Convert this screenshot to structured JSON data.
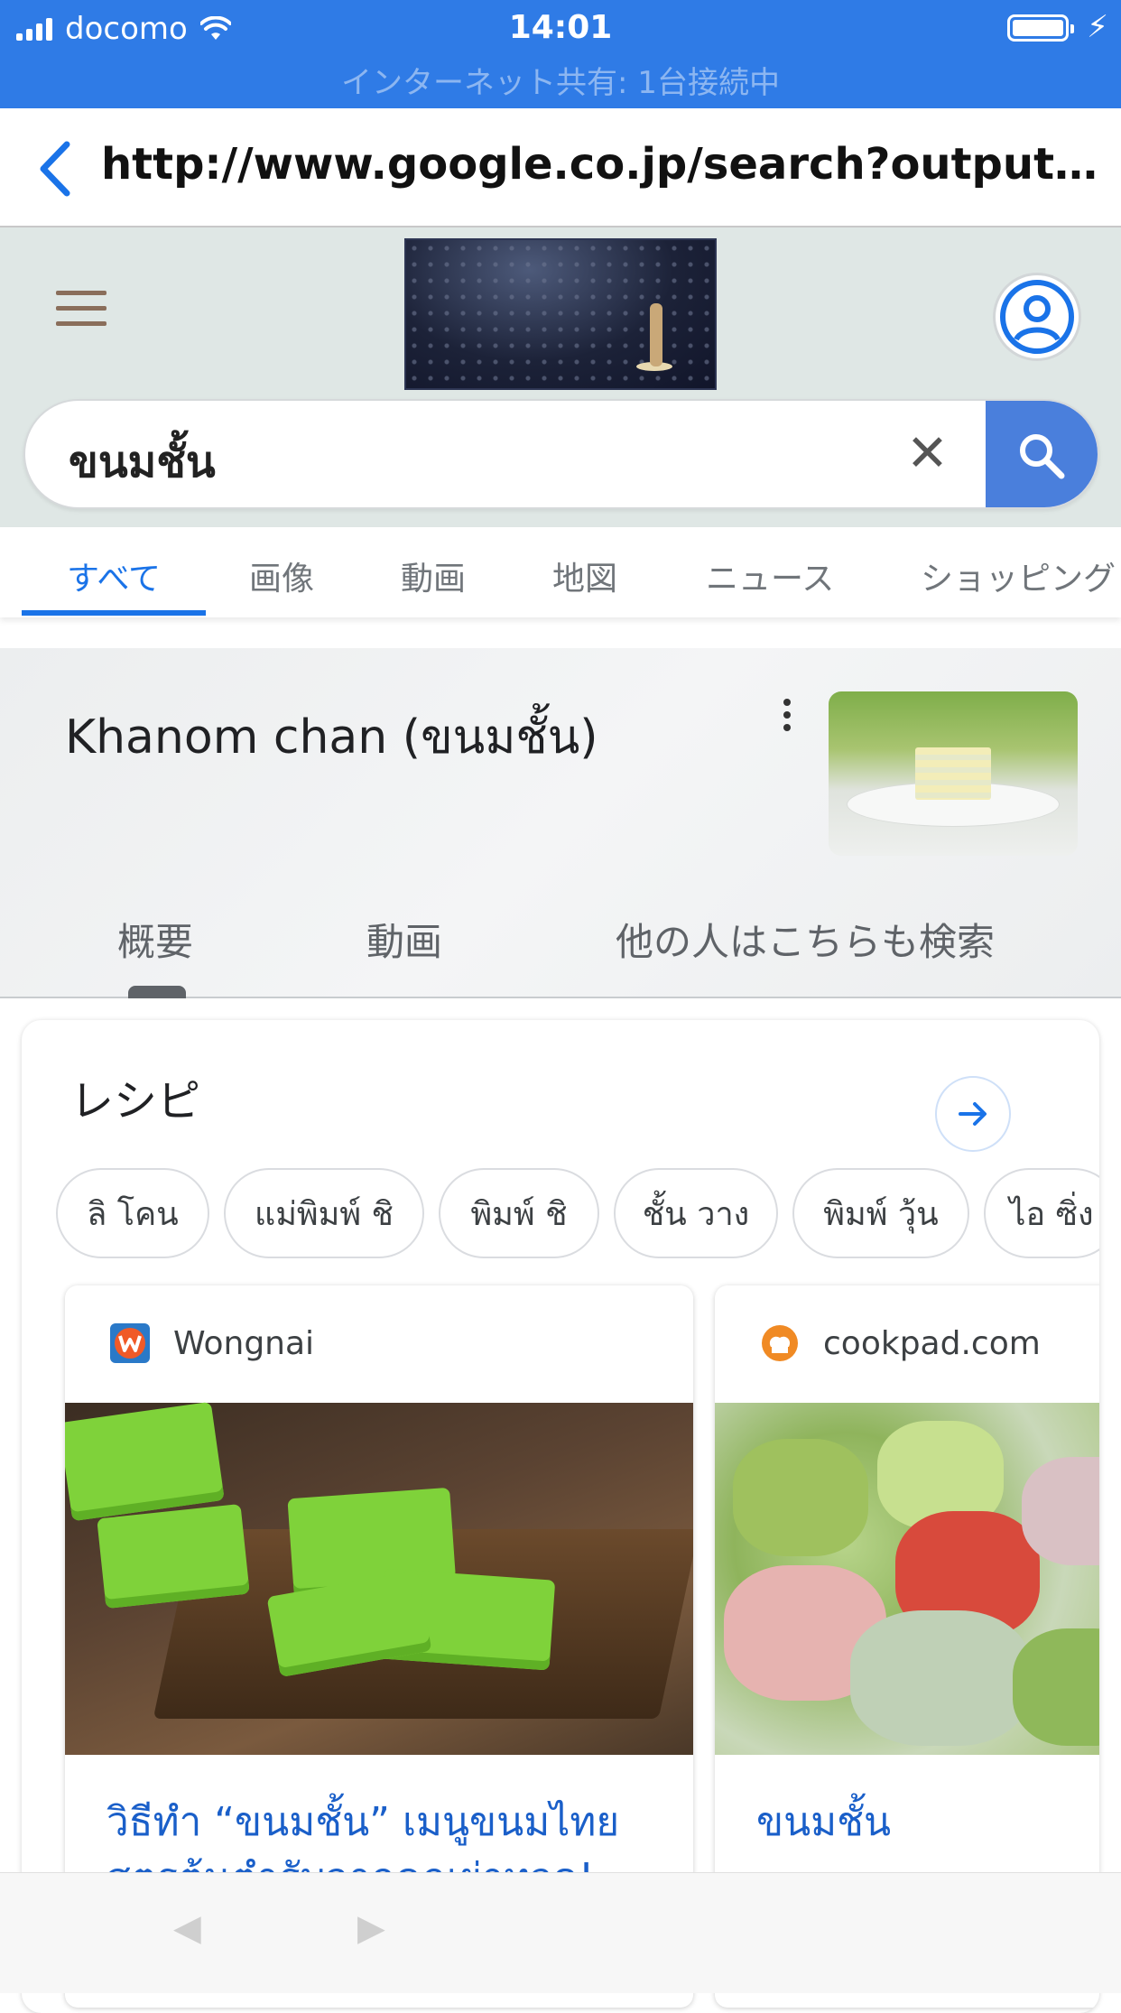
{
  "status_bar": {
    "carrier": "docomo",
    "time": "14:01",
    "hotspot": "インターネット共有: 1台接続中"
  },
  "browser": {
    "url": "http://www.google.co.jp/search?output=&s..."
  },
  "search": {
    "query": "ขนมชั้น",
    "clear_glyph": "✕"
  },
  "tabs": [
    {
      "label": "すべて",
      "active": true
    },
    {
      "label": "画像"
    },
    {
      "label": "動画"
    },
    {
      "label": "地図"
    },
    {
      "label": "ニュース"
    },
    {
      "label": "ショッピング"
    }
  ],
  "knowledge_panel": {
    "title": "Khanom chan (ขนมชั้น)",
    "subtabs": [
      "概要",
      "動画",
      "他の人はこちらも検索"
    ]
  },
  "recipes": {
    "heading": "レシピ",
    "chips": [
      "ลิ โคน",
      "แม่พิมพ์ ชิ",
      "พิมพ์ ชิ",
      "ชั้น วาง",
      "พิมพ์ วุ้น",
      "ไอ ซิ่ง"
    ],
    "cards": [
      {
        "source": "Wongnai",
        "title": "วิธีทำ “ขนมชั้น” เมนูขนมไทย สูตรต้นตำรับจากคุณย่าทวด!"
      },
      {
        "source": "cookpad.com",
        "title": "ขนมชั้น"
      }
    ]
  },
  "toolbar": {
    "back_glyph": "◀",
    "forward_glyph": "▶"
  },
  "colors": {
    "status_bar": "#2f7be6",
    "accent": "#1a73e8",
    "search_button": "#4a7fdc",
    "link": "#1a5fc9"
  }
}
